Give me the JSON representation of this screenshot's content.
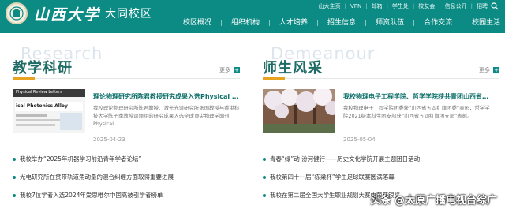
{
  "header": {
    "school_name": "山西大学",
    "campus": "大同校区",
    "top_links": [
      "山大主页",
      "VPN",
      "邮箱",
      "学生处",
      "校友会",
      "信息公开",
      "招聘"
    ],
    "nav": [
      "校区概况",
      "组织机构",
      "人才培养",
      "招生信息",
      "师资队伍",
      "合作交流",
      "校园生活"
    ]
  },
  "teaching": {
    "watermark": "Research",
    "title": "教学科研",
    "more": "更多",
    "feature": {
      "title": "理论物理研究所陈君教授研究成果入选Physical Review Let...",
      "desc": "我校理论物理研究所陈君教授、激光光谱研究所张国教授与香港科技大学陈子季教授课题组的研究成果入选全球顶尖物理学期刊Physical...",
      "date": "2025-04-23",
      "thumb_text": [
        "Physical Review Letters",
        "ical Photonics Alloy"
      ]
    },
    "list": [
      "我校举办“2025年机器学习前沿青年学者论坛”",
      "光电研究所在贯带轨道角动量的混合纠缠方面取得重要进展",
      "我校7位学者入选2024年爱思唯尔中国高被引学者榜单"
    ]
  },
  "faculty": {
    "watermark": "Demeanour",
    "title": "师生风采",
    "more": "更多",
    "feature": {
      "title": "我校物理电子工程学院、哲学学院获共青团山西省委表彰",
      "desc": "我校物理电子工程学院团委获“山西省五四红旗团委”表彰，哲学学院2021级本科生团支部获“山西省五四红旗团支部”表彰。",
      "date": "2025-05-04"
    },
    "list": [
      "青春“绿”动 汾河健行——历史文化学院开展主题团日活动",
      "我校第四十一届“栋梁杯”学生足球联赛圆满落幕",
      "我校在第二届全国大学生职业规划大赛中荣获银奖"
    ]
  },
  "watermark": "头条 @太原广播电视台综广"
}
